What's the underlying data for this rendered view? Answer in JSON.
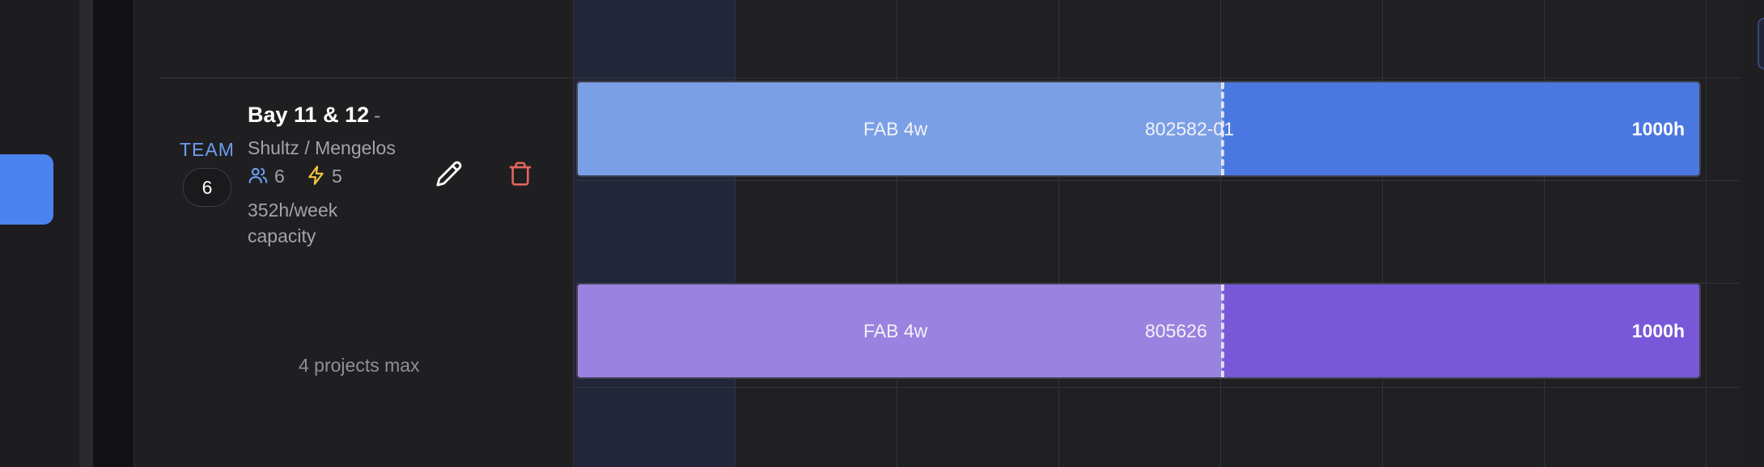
{
  "team": {
    "label": "TEAM",
    "count": "6"
  },
  "bay": {
    "name": "Bay 11 & 12",
    "dash": "-",
    "leads": "Shultz / Mengelos",
    "people_count": "6",
    "bolt_count": "5",
    "capacity": "352h/week capacity",
    "max_projects": "4 projects max"
  },
  "icons": {
    "people": "users-icon",
    "bolt": "lightning-icon",
    "edit": "pencil-icon",
    "delete": "trash-icon"
  },
  "colors": {
    "accent_blue": "#4b83f0",
    "team_label": "#6f9cf2",
    "bolt": "#f5c542",
    "delete": "#e0635c",
    "bar1_light": "#7b9fe6",
    "bar1_dark": "#4a78e0",
    "bar2_light": "#9a82e0",
    "bar2_dark": "#7858d8"
  },
  "projects": [
    {
      "phase": "FAB 4w",
      "job": "802582-01",
      "hours": "1000h"
    },
    {
      "phase": "FAB 4w",
      "job": "805626",
      "hours": "1000h"
    }
  ]
}
